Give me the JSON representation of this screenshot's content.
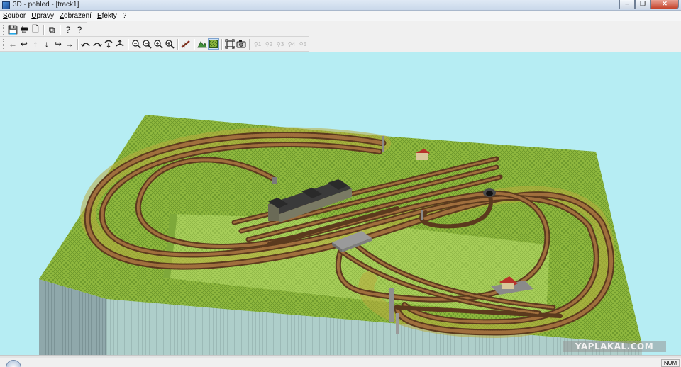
{
  "window": {
    "title": "3D - pohled - [track1]",
    "minimize": "–",
    "restore": "❐",
    "close": "✕"
  },
  "menu": [
    {
      "first": "S",
      "rest": "oubor"
    },
    {
      "first": "U",
      "rest": "pravy"
    },
    {
      "first": "Z",
      "rest": "obrazení"
    },
    {
      "first": "E",
      "rest": "fekty"
    },
    {
      "first": "?",
      "rest": ""
    }
  ],
  "toolbar1": {
    "save": "💾",
    "print": "🖶",
    "print_preview": "🗋",
    "copy": "⧉",
    "help": "?",
    "context_help": "?"
  },
  "toolbar2": {
    "move_left": "←",
    "move_back": "↩",
    "move_up": "↑",
    "move_down": "↓",
    "move_forward": "↪",
    "move_right": "→",
    "zoom_out_minus": "−",
    "zoom_out": "−",
    "zoom_in": "+",
    "zoom_fit": "+",
    "camera_1": "1",
    "camera_2": "2",
    "camera_3": "3",
    "camera_4": "4",
    "camera_5": "5"
  },
  "colors": {
    "sky": "#b6edf3",
    "grass": "#8fb83e",
    "wall": "#9eb7b6",
    "rail": "#6b4425",
    "sleeper": "#8a5a2f",
    "ballast": "#c0b04a"
  },
  "watermark": "YAPLAKAL.COM",
  "status": {
    "num": "NUM"
  }
}
